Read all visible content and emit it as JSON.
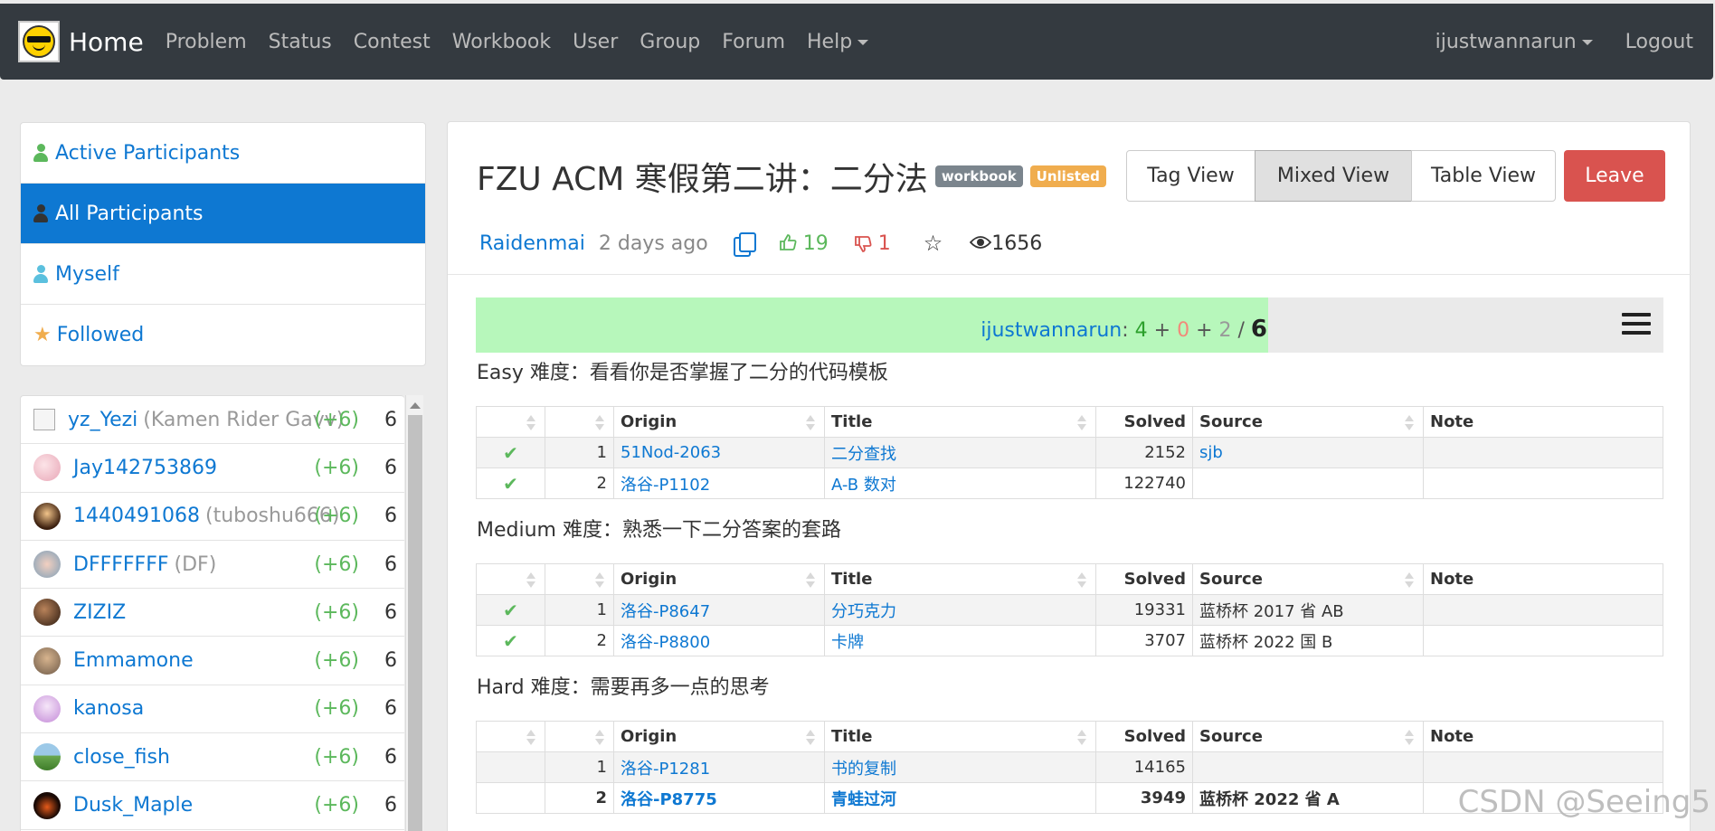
{
  "nav": {
    "brand": "Home",
    "items": [
      "Problem",
      "Status",
      "Contest",
      "Workbook",
      "User",
      "Group",
      "Forum"
    ],
    "help": "Help",
    "user": "ijustwannarun",
    "logout": "Logout"
  },
  "filters": [
    "Active Participants",
    "All Participants",
    "Myself",
    "Followed"
  ],
  "participants": [
    {
      "name": "yz_Yezi",
      "nick": "(Kamen Rider Gavv)",
      "delta": "(+6)",
      "score": "6"
    },
    {
      "name": "Jay142753869",
      "nick": "",
      "delta": "(+6)",
      "score": "6"
    },
    {
      "name": "1440491068",
      "nick": "(tuboshu666)",
      "delta": "(+6)",
      "score": "6"
    },
    {
      "name": "DFFFFFFF",
      "nick": "(DF)",
      "delta": "(+6)",
      "score": "6"
    },
    {
      "name": "ZIZIZ",
      "nick": "",
      "delta": "(+6)",
      "score": "6"
    },
    {
      "name": "Emmamone",
      "nick": "",
      "delta": "(+6)",
      "score": "6"
    },
    {
      "name": "kanosa",
      "nick": "",
      "delta": "(+6)",
      "score": "6"
    },
    {
      "name": "close_fish",
      "nick": "",
      "delta": "(+6)",
      "score": "6"
    },
    {
      "name": "Dusk_Maple",
      "nick": "",
      "delta": "(+6)",
      "score": "6"
    }
  ],
  "workbook": {
    "title": "FZU ACM 寒假第二讲：二分法",
    "badges": [
      "workbook",
      "Unlisted"
    ],
    "views": [
      "Tag View",
      "Mixed View",
      "Table View"
    ],
    "active_view": "Mixed View",
    "leave": "Leave",
    "author": "Raidenmai",
    "time": "2 days ago",
    "upvotes": "19",
    "downvotes": "1",
    "view_count": "1656"
  },
  "progress": {
    "user": "ijustwannarun",
    "accepted": "4",
    "wrong": "0",
    "pending": "2",
    "total": "6",
    "fraction": 0.667
  },
  "table_headers": [
    "Origin",
    "Title",
    "Solved",
    "Source",
    "Note"
  ],
  "sections": [
    {
      "title": "Easy 难度：看看你是否掌握了二分的代码模板",
      "rows": [
        {
          "solved_mark": "✔",
          "idx": "1",
          "origin": "51Nod-2063",
          "title": "二分查找",
          "solved": "2152",
          "source": "sjb",
          "note": ""
        },
        {
          "solved_mark": "✔",
          "idx": "2",
          "origin": "洛谷-P1102",
          "title": "A-B 数对",
          "solved": "122740",
          "source": "",
          "note": ""
        }
      ]
    },
    {
      "title": "Medium 难度：熟悉一下二分答案的套路",
      "rows": [
        {
          "solved_mark": "✔",
          "idx": "1",
          "origin": "洛谷-P8647",
          "title": "分巧克力",
          "solved": "19331",
          "source": "蓝桥杯 2017 省 AB",
          "note": ""
        },
        {
          "solved_mark": "✔",
          "idx": "2",
          "origin": "洛谷-P8800",
          "title": "卡牌",
          "solved": "3707",
          "source": "蓝桥杯 2022 国 B",
          "note": ""
        }
      ]
    },
    {
      "title": "Hard 难度：需要再多一点的思考",
      "rows": [
        {
          "solved_mark": "",
          "idx": "1",
          "origin": "洛谷-P1281",
          "title": "书的复制",
          "solved": "14165",
          "source": "",
          "note": ""
        },
        {
          "solved_mark": "",
          "idx": "2",
          "origin": "洛谷-P8775",
          "title": "青蛙过河",
          "solved": "3949",
          "source": "蓝桥杯 2022 省 A",
          "note": ""
        }
      ]
    }
  ],
  "watermark": "CSDN @Seeing5",
  "colors": {
    "navbar": "#343a40",
    "link": "#0e78d2",
    "active": "#0e78d2",
    "success": "#5cb85c",
    "danger": "#d9534f",
    "warning": "#f0ad4e",
    "progress_fill": "#b7f7bb"
  }
}
